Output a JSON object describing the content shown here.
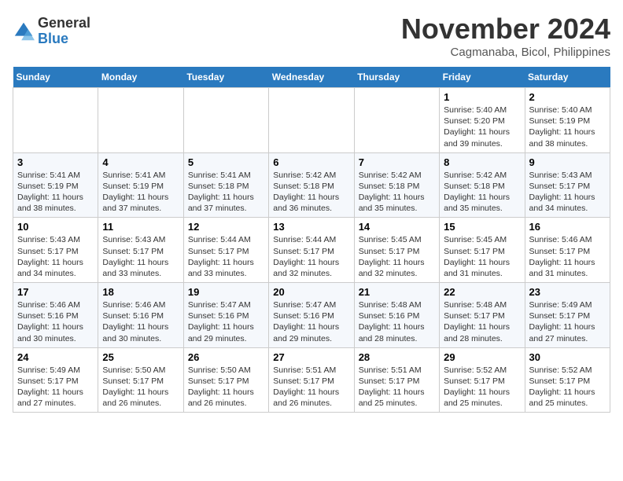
{
  "header": {
    "logo_general": "General",
    "logo_blue": "Blue",
    "month_title": "November 2024",
    "location": "Cagmanaba, Bicol, Philippines"
  },
  "columns": [
    "Sunday",
    "Monday",
    "Tuesday",
    "Wednesday",
    "Thursday",
    "Friday",
    "Saturday"
  ],
  "weeks": [
    [
      {
        "day": "",
        "detail": ""
      },
      {
        "day": "",
        "detail": ""
      },
      {
        "day": "",
        "detail": ""
      },
      {
        "day": "",
        "detail": ""
      },
      {
        "day": "",
        "detail": ""
      },
      {
        "day": "1",
        "detail": "Sunrise: 5:40 AM\nSunset: 5:20 PM\nDaylight: 11 hours and 39 minutes."
      },
      {
        "day": "2",
        "detail": "Sunrise: 5:40 AM\nSunset: 5:19 PM\nDaylight: 11 hours and 38 minutes."
      }
    ],
    [
      {
        "day": "3",
        "detail": "Sunrise: 5:41 AM\nSunset: 5:19 PM\nDaylight: 11 hours and 38 minutes."
      },
      {
        "day": "4",
        "detail": "Sunrise: 5:41 AM\nSunset: 5:19 PM\nDaylight: 11 hours and 37 minutes."
      },
      {
        "day": "5",
        "detail": "Sunrise: 5:41 AM\nSunset: 5:18 PM\nDaylight: 11 hours and 37 minutes."
      },
      {
        "day": "6",
        "detail": "Sunrise: 5:42 AM\nSunset: 5:18 PM\nDaylight: 11 hours and 36 minutes."
      },
      {
        "day": "7",
        "detail": "Sunrise: 5:42 AM\nSunset: 5:18 PM\nDaylight: 11 hours and 35 minutes."
      },
      {
        "day": "8",
        "detail": "Sunrise: 5:42 AM\nSunset: 5:18 PM\nDaylight: 11 hours and 35 minutes."
      },
      {
        "day": "9",
        "detail": "Sunrise: 5:43 AM\nSunset: 5:17 PM\nDaylight: 11 hours and 34 minutes."
      }
    ],
    [
      {
        "day": "10",
        "detail": "Sunrise: 5:43 AM\nSunset: 5:17 PM\nDaylight: 11 hours and 34 minutes."
      },
      {
        "day": "11",
        "detail": "Sunrise: 5:43 AM\nSunset: 5:17 PM\nDaylight: 11 hours and 33 minutes."
      },
      {
        "day": "12",
        "detail": "Sunrise: 5:44 AM\nSunset: 5:17 PM\nDaylight: 11 hours and 33 minutes."
      },
      {
        "day": "13",
        "detail": "Sunrise: 5:44 AM\nSunset: 5:17 PM\nDaylight: 11 hours and 32 minutes."
      },
      {
        "day": "14",
        "detail": "Sunrise: 5:45 AM\nSunset: 5:17 PM\nDaylight: 11 hours and 32 minutes."
      },
      {
        "day": "15",
        "detail": "Sunrise: 5:45 AM\nSunset: 5:17 PM\nDaylight: 11 hours and 31 minutes."
      },
      {
        "day": "16",
        "detail": "Sunrise: 5:46 AM\nSunset: 5:17 PM\nDaylight: 11 hours and 31 minutes."
      }
    ],
    [
      {
        "day": "17",
        "detail": "Sunrise: 5:46 AM\nSunset: 5:16 PM\nDaylight: 11 hours and 30 minutes."
      },
      {
        "day": "18",
        "detail": "Sunrise: 5:46 AM\nSunset: 5:16 PM\nDaylight: 11 hours and 30 minutes."
      },
      {
        "day": "19",
        "detail": "Sunrise: 5:47 AM\nSunset: 5:16 PM\nDaylight: 11 hours and 29 minutes."
      },
      {
        "day": "20",
        "detail": "Sunrise: 5:47 AM\nSunset: 5:16 PM\nDaylight: 11 hours and 29 minutes."
      },
      {
        "day": "21",
        "detail": "Sunrise: 5:48 AM\nSunset: 5:16 PM\nDaylight: 11 hours and 28 minutes."
      },
      {
        "day": "22",
        "detail": "Sunrise: 5:48 AM\nSunset: 5:17 PM\nDaylight: 11 hours and 28 minutes."
      },
      {
        "day": "23",
        "detail": "Sunrise: 5:49 AM\nSunset: 5:17 PM\nDaylight: 11 hours and 27 minutes."
      }
    ],
    [
      {
        "day": "24",
        "detail": "Sunrise: 5:49 AM\nSunset: 5:17 PM\nDaylight: 11 hours and 27 minutes."
      },
      {
        "day": "25",
        "detail": "Sunrise: 5:50 AM\nSunset: 5:17 PM\nDaylight: 11 hours and 26 minutes."
      },
      {
        "day": "26",
        "detail": "Sunrise: 5:50 AM\nSunset: 5:17 PM\nDaylight: 11 hours and 26 minutes."
      },
      {
        "day": "27",
        "detail": "Sunrise: 5:51 AM\nSunset: 5:17 PM\nDaylight: 11 hours and 26 minutes."
      },
      {
        "day": "28",
        "detail": "Sunrise: 5:51 AM\nSunset: 5:17 PM\nDaylight: 11 hours and 25 minutes."
      },
      {
        "day": "29",
        "detail": "Sunrise: 5:52 AM\nSunset: 5:17 PM\nDaylight: 11 hours and 25 minutes."
      },
      {
        "day": "30",
        "detail": "Sunrise: 5:52 AM\nSunset: 5:17 PM\nDaylight: 11 hours and 25 minutes."
      }
    ]
  ]
}
